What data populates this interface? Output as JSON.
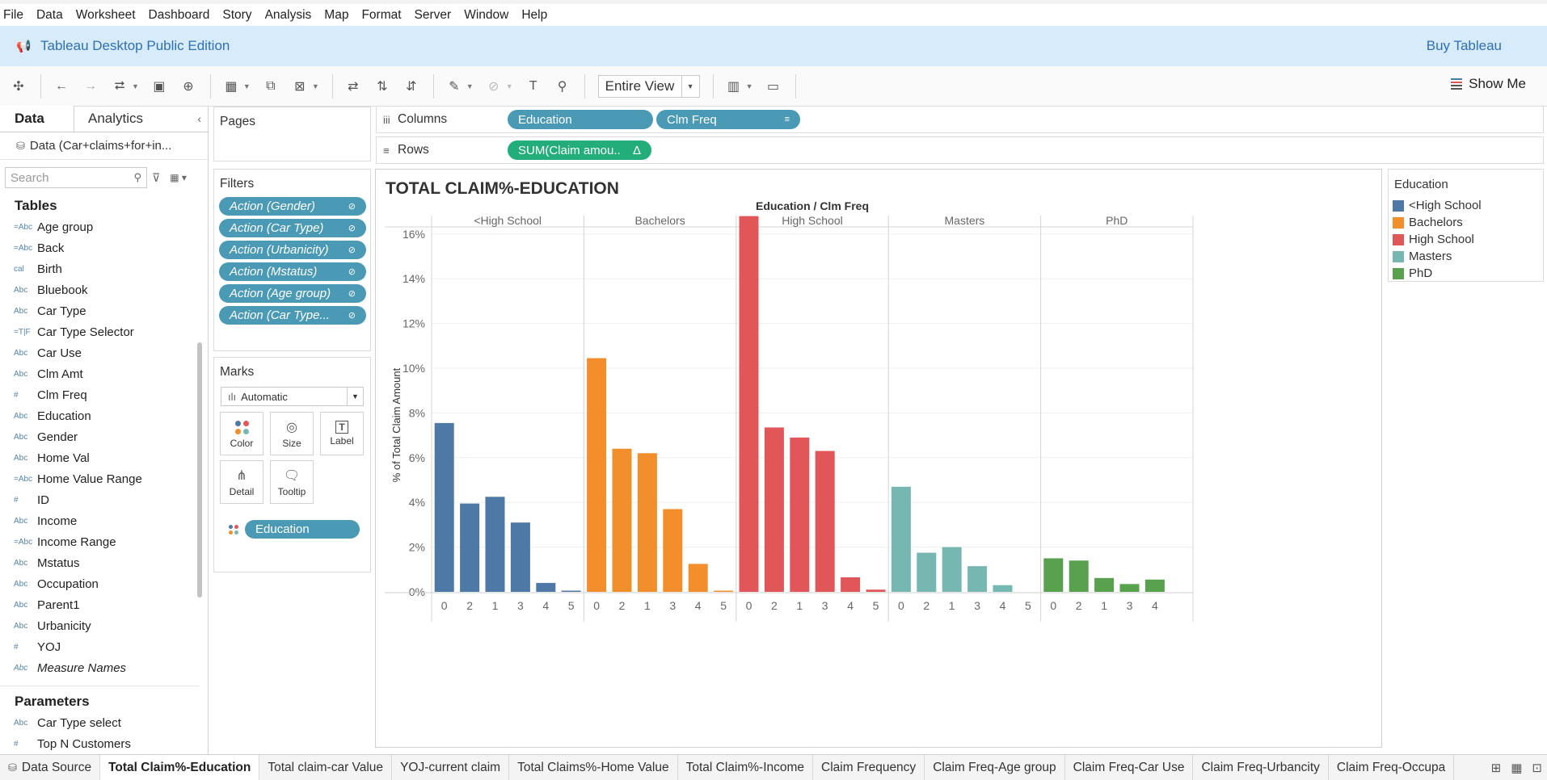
{
  "menu": [
    "File",
    "Data",
    "Worksheet",
    "Dashboard",
    "Story",
    "Analysis",
    "Map",
    "Format",
    "Server",
    "Window",
    "Help"
  ],
  "banner": {
    "title": "Tableau Desktop Public Edition",
    "buy": "Buy Tableau"
  },
  "toolbar": {
    "fit": "Entire View",
    "show_me": "Show Me"
  },
  "side": {
    "tab_data": "Data",
    "tab_analytics": "Analytics",
    "datasource": "Data (Car+claims+for+in...",
    "search_placeholder": "Search",
    "tables_heading": "Tables",
    "fields": [
      {
        "type": "=Abc",
        "name": "Age group"
      },
      {
        "type": "=Abc",
        "name": "Back"
      },
      {
        "type": "cal",
        "name": "Birth"
      },
      {
        "type": "Abc",
        "name": "Bluebook"
      },
      {
        "type": "Abc",
        "name": "Car Type"
      },
      {
        "type": "=T|F",
        "name": "Car Type Selector"
      },
      {
        "type": "Abc",
        "name": "Car Use"
      },
      {
        "type": "Abc",
        "name": "Clm Amt"
      },
      {
        "type": "#",
        "name": "Clm Freq"
      },
      {
        "type": "Abc",
        "name": "Education"
      },
      {
        "type": "Abc",
        "name": "Gender"
      },
      {
        "type": "Abc",
        "name": "Home Val"
      },
      {
        "type": "=Abc",
        "name": "Home Value Range"
      },
      {
        "type": "#",
        "name": "ID"
      },
      {
        "type": "Abc",
        "name": "Income"
      },
      {
        "type": "=Abc",
        "name": "Income Range"
      },
      {
        "type": "Abc",
        "name": "Mstatus"
      },
      {
        "type": "Abc",
        "name": "Occupation"
      },
      {
        "type": "Abc",
        "name": "Parent1"
      },
      {
        "type": "Abc",
        "name": "Urbanicity"
      },
      {
        "type": "#",
        "name": "YOJ"
      },
      {
        "type": "Abc",
        "name": "Measure Names",
        "italic": true
      }
    ],
    "parameters_heading": "Parameters",
    "parameters": [
      {
        "type": "Abc",
        "name": "Car Type select"
      },
      {
        "type": "#",
        "name": "Top N Customers"
      }
    ]
  },
  "pages": {
    "title": "Pages"
  },
  "filters": {
    "title": "Filters",
    "items": [
      "Action (Gender)",
      "Action (Car Type)",
      "Action (Urbanicity)",
      "Action (Mstatus)",
      "Action (Age group)",
      "Action (Car Type..."
    ]
  },
  "marks": {
    "title": "Marks",
    "type": "Automatic",
    "buttons": [
      "Color",
      "Size",
      "Label",
      "Detail",
      "Tooltip"
    ],
    "pill": "Education"
  },
  "shelves": {
    "columns_label": "Columns",
    "rows_label": "Rows",
    "columns": [
      "Education",
      "Clm Freq"
    ],
    "rows": [
      "SUM(Claim amou..",
      "Δ"
    ]
  },
  "colors": {
    "hs_less": "#4e79a7",
    "bachelors": "#f28e2b",
    "high_school": "#e15759",
    "masters": "#76b7b2",
    "phd": "#59a14f"
  },
  "chart_data": {
    "type": "bar",
    "title": "TOTAL CLAIM%-EDUCATION",
    "header": "Education / Clm Freq",
    "ylabel": "% of Total Claim Amount",
    "ylim": [
      0,
      17
    ],
    "yticks": [
      "0%",
      "2%",
      "4%",
      "6%",
      "8%",
      "10%",
      "12%",
      "14%",
      "16%"
    ],
    "panes": [
      {
        "name": "<High School",
        "color": "#4e79a7",
        "categories": [
          "0",
          "2",
          "1",
          "3",
          "4",
          "5"
        ],
        "values": [
          7.55,
          3.95,
          4.25,
          3.1,
          0.4,
          0.05
        ]
      },
      {
        "name": "Bachelors",
        "color": "#f28e2b",
        "categories": [
          "0",
          "2",
          "1",
          "3",
          "4",
          "5"
        ],
        "values": [
          10.45,
          6.4,
          6.2,
          3.7,
          1.25,
          0.05
        ]
      },
      {
        "name": "High School",
        "color": "#e15759",
        "categories": [
          "0",
          "2",
          "1",
          "3",
          "4",
          "5"
        ],
        "values": [
          16.8,
          7.35,
          6.9,
          6.3,
          0.65,
          0.1
        ]
      },
      {
        "name": "Masters",
        "color": "#76b7b2",
        "categories": [
          "0",
          "2",
          "1",
          "3",
          "4",
          "5"
        ],
        "values": [
          4.7,
          1.75,
          2.0,
          1.15,
          0.3,
          0
        ]
      },
      {
        "name": "PhD",
        "color": "#59a14f",
        "categories": [
          "0",
          "2",
          "1",
          "3",
          "4"
        ],
        "values": [
          1.5,
          1.4,
          0.62,
          0.35,
          0.55
        ]
      }
    ]
  },
  "legend": {
    "title": "Education",
    "items": [
      {
        "label": "<High School",
        "color": "#4e79a7"
      },
      {
        "label": "Bachelors",
        "color": "#f28e2b"
      },
      {
        "label": "High School",
        "color": "#e15759"
      },
      {
        "label": "Masters",
        "color": "#76b7b2"
      },
      {
        "label": "PhD",
        "color": "#59a14f"
      }
    ]
  },
  "sheets": {
    "datasource": "Data Source",
    "tabs": [
      "Total Claim%-Education",
      "Total claim-car Value",
      "YOJ-current claim",
      "Total Claims%-Home Value",
      "Total Claim%-Income",
      "Claim Frequency",
      "Claim Freq-Age group",
      "Claim Freq-Car Use",
      "Claim Freq-Urbancity",
      "Claim Freq-Occupa"
    ]
  }
}
